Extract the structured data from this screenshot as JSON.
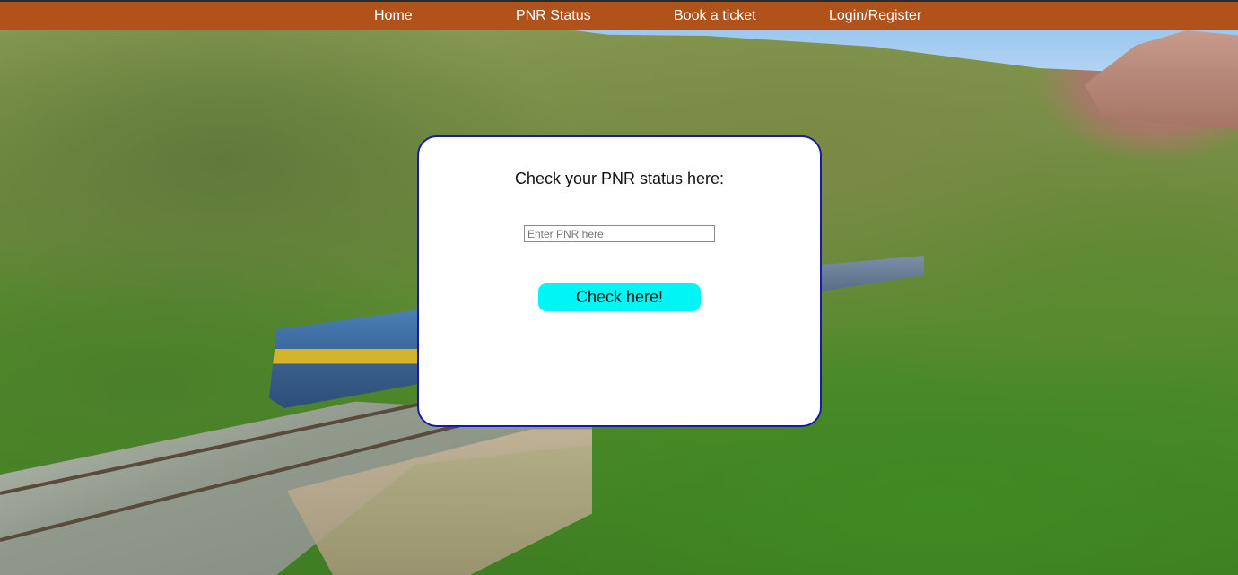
{
  "navbar": {
    "items": [
      {
        "label": "Home"
      },
      {
        "label": "PNR Status"
      },
      {
        "label": "Book a ticket"
      },
      {
        "label": "Login/Register"
      }
    ],
    "color": "#b0521a"
  },
  "pnr_card": {
    "title": "Check your PNR status here:",
    "input": {
      "placeholder": "Enter PNR here",
      "value": ""
    },
    "button_label": "Check here!",
    "button_color": "#00f5f5",
    "border_color": "#1a1aa8"
  },
  "background": {
    "icon": "train-landscape-photo"
  }
}
